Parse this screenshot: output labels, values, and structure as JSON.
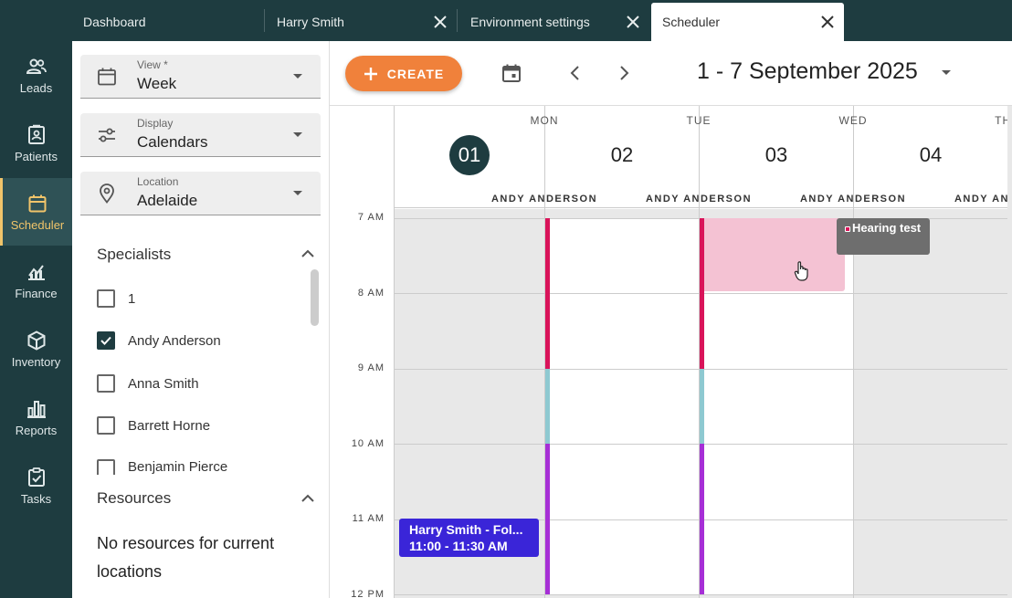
{
  "tabs": [
    {
      "label": "Dashboard",
      "closable": false
    },
    {
      "label": "Harry Smith",
      "closable": true
    },
    {
      "label": "Environment settings",
      "closable": true
    },
    {
      "label": "Scheduler",
      "closable": true,
      "active": true
    }
  ],
  "nav": {
    "items": [
      {
        "label": "Leads",
        "icon": "people-icon"
      },
      {
        "label": "Patients",
        "icon": "id-card-icon"
      },
      {
        "label": "Scheduler",
        "icon": "calendar-icon",
        "active": true
      },
      {
        "label": "Finance",
        "icon": "chart-icon"
      },
      {
        "label": "Inventory",
        "icon": "cube-icon"
      },
      {
        "label": "Reports",
        "icon": "bar-chart-icon"
      },
      {
        "label": "Tasks",
        "icon": "clipboard-check-icon"
      }
    ]
  },
  "filters": {
    "view": {
      "label": "View *",
      "value": "Week"
    },
    "display": {
      "label": "Display",
      "value": "Calendars"
    },
    "location": {
      "label": "Location",
      "value": "Adelaide"
    }
  },
  "specialists": {
    "title": "Specialists",
    "items": [
      {
        "label": "1",
        "checked": false
      },
      {
        "label": "Andy Anderson",
        "checked": true
      },
      {
        "label": "Anna Smith",
        "checked": false
      },
      {
        "label": "Barrett Horne",
        "checked": false
      },
      {
        "label": "Benjamin Pierce",
        "checked": false
      }
    ]
  },
  "resources": {
    "title": "Resources",
    "empty_text": "No resources for current locations"
  },
  "toolbar": {
    "create_label": "CREATE",
    "date_range": "1 - 7 September 2025"
  },
  "days": [
    {
      "name": "MON",
      "num": "01",
      "person": "ANDY ANDERSON",
      "today": true
    },
    {
      "name": "TUE",
      "num": "02",
      "person": "ANDY ANDERSON"
    },
    {
      "name": "WED",
      "num": "03",
      "person": "ANDY ANDERSON"
    },
    {
      "name": "THU",
      "num": "04",
      "person": "ANDY ANDERSON"
    }
  ],
  "times": [
    "7 AM",
    "8 AM",
    "9 AM",
    "10 AM",
    "11 AM",
    "12 PM"
  ],
  "events": {
    "harry": {
      "title": "Harry Smith - Fol...",
      "time": "11:00 - 11:30 AM",
      "color": "#3a25d8"
    },
    "hearing": {
      "title": "Hearing test",
      "color": "#6e6e6e"
    },
    "wed_block": {
      "color": "#f4c2d3"
    }
  },
  "colors": {
    "brand_dark": "#1e3c40",
    "accent_orange": "#f0813b",
    "highlight_gold": "#f0c46a",
    "avail_red": "#d9145a",
    "avail_teal": "#8ec9d1",
    "avail_purple": "#a62fd6"
  }
}
